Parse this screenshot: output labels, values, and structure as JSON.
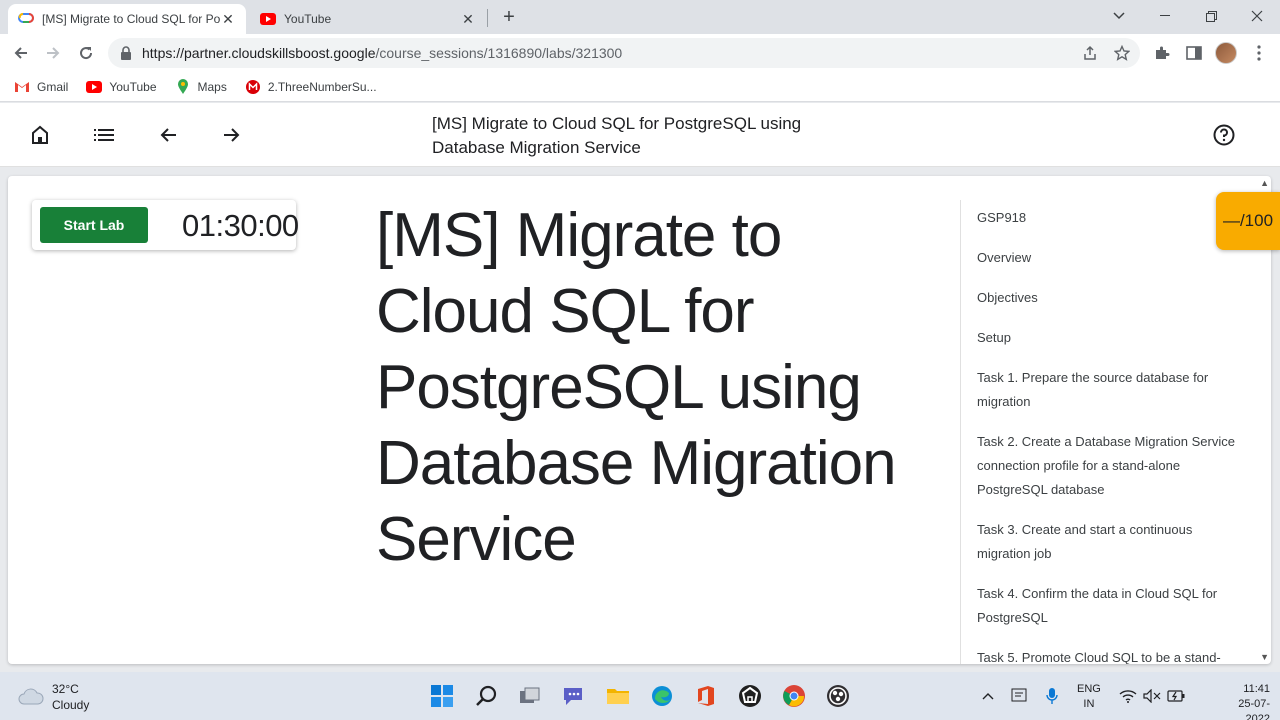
{
  "browser": {
    "tabs": [
      {
        "title": "[MS] Migrate to Cloud SQL for Po",
        "icon": "google-cloud-icon",
        "active": true
      },
      {
        "title": "YouTube",
        "icon": "youtube-icon",
        "active": false
      }
    ],
    "url_host": "https://partner.cloudskillsboost.google",
    "url_path": "/course_sessions/1316890/labs/321300",
    "bookmarks": [
      {
        "label": "Gmail",
        "icon": "gmail-icon"
      },
      {
        "label": "YouTube",
        "icon": "youtube-icon"
      },
      {
        "label": "Maps",
        "icon": "maps-icon"
      },
      {
        "label": "2.ThreeNumberSu...",
        "icon": "mega-icon"
      }
    ]
  },
  "header": {
    "title": "[MS] Migrate to Cloud SQL for PostgreSQL using Database Migration Service"
  },
  "lab": {
    "start_label": "Start Lab",
    "timer": "01:30:00",
    "title": "[MS] Migrate to Cloud SQL for PostgreSQL using Database Migration Service",
    "score": "—/100"
  },
  "toc": [
    "GSP918",
    "Overview",
    "Objectives",
    "Setup",
    "Task 1. Prepare the source database for migration",
    "Task 2. Create a Database Migration Service connection profile for a stand-alone PostgreSQL database",
    "Task 3. Create and start a continuous migration job",
    "Task 4. Confirm the data in Cloud SQL for PostgreSQL",
    "Task 5. Promote Cloud SQL to be a stand-"
  ],
  "taskbar": {
    "weather_temp": "32°C",
    "weather_text": "Cloudy",
    "lang1": "ENG",
    "lang2": "IN",
    "time": "11:41",
    "date": "25-07-2022"
  },
  "colors": {
    "start_button": "#188038",
    "score_badge": "#f9ab00"
  }
}
